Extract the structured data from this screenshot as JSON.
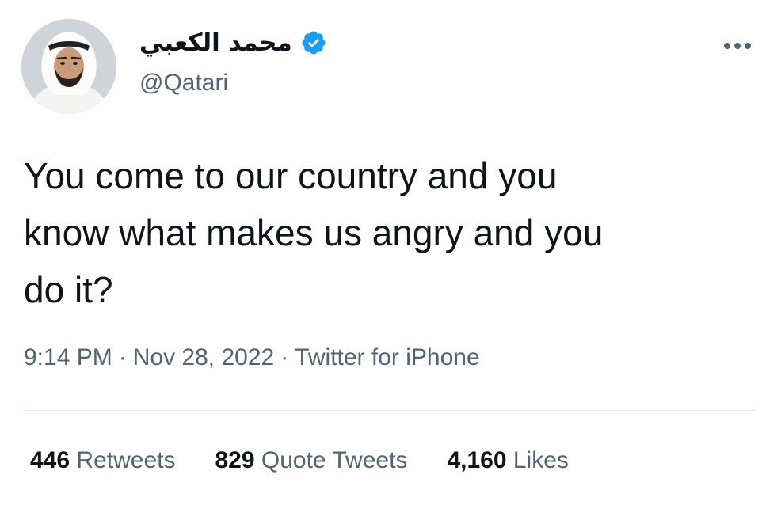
{
  "author": {
    "display_name": "محمد الكعبي",
    "handle": "@Qatari",
    "verified": true,
    "avatar_icon": "profile-photo"
  },
  "tweet": {
    "text": "You come to our country and you\nknow what makes us angry and you\ndo it?",
    "time": "9:14 PM",
    "date": "Nov 28, 2022",
    "separator": "·",
    "source": "Twitter for iPhone"
  },
  "stats": {
    "retweets_count": "446",
    "retweets_label": "Retweets",
    "quotes_count": "829",
    "quotes_label": "Quote Tweets",
    "likes_count": "4,160",
    "likes_label": "Likes"
  },
  "colors": {
    "text_primary": "#0f1419",
    "text_secondary": "#536471",
    "verified_blue": "#1d9bf0",
    "divider": "#e6e9ec"
  }
}
